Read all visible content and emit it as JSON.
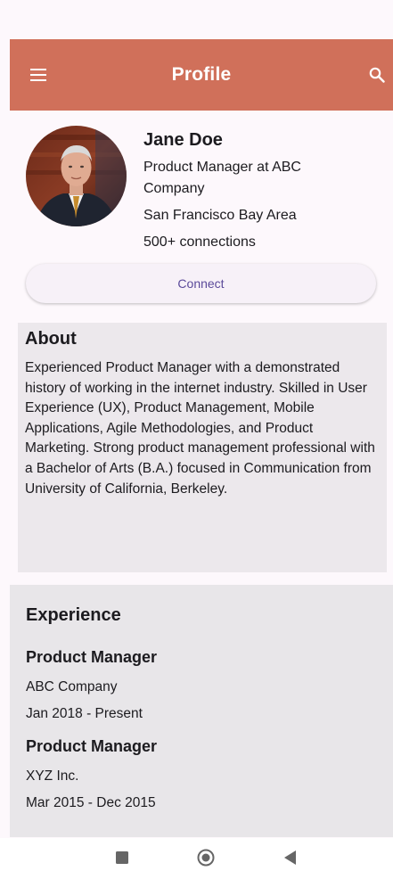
{
  "app_bar": {
    "title": "Profile",
    "color": "#d0705a",
    "menu_icon": "hamburger-menu-icon",
    "search_icon": "search-icon"
  },
  "profile": {
    "name": "Jane Doe",
    "headline_line1": "Product Manager at ABC",
    "headline_line2": "Company",
    "location": "San Francisco Bay Area",
    "connections": "500+ connections",
    "connect_label": "Connect",
    "avatar_icon": "profile-photo-avatar"
  },
  "about": {
    "title": "About",
    "text": "Experienced Product Manager with a demonstrated history of working in the internet industry. Skilled in User Experience (UX), Product Management, Mobile Applications, Agile Methodologies, and Product Marketing. Strong product management professional with a Bachelor of Arts (B.A.) focused in Communication from University of California, Berkeley."
  },
  "experience": {
    "title": "Experience",
    "items": [
      {
        "title": "Product Manager",
        "company": "ABC Company",
        "dates": "Jan 2018 - Present"
      },
      {
        "title": "Product Manager",
        "company": "XYZ Inc.",
        "dates": "Mar 2015 - Dec 2015"
      }
    ]
  },
  "nav_bar": {
    "recents_icon": "square-recents-icon",
    "home_icon": "circle-home-icon",
    "back_icon": "triangle-back-icon"
  }
}
